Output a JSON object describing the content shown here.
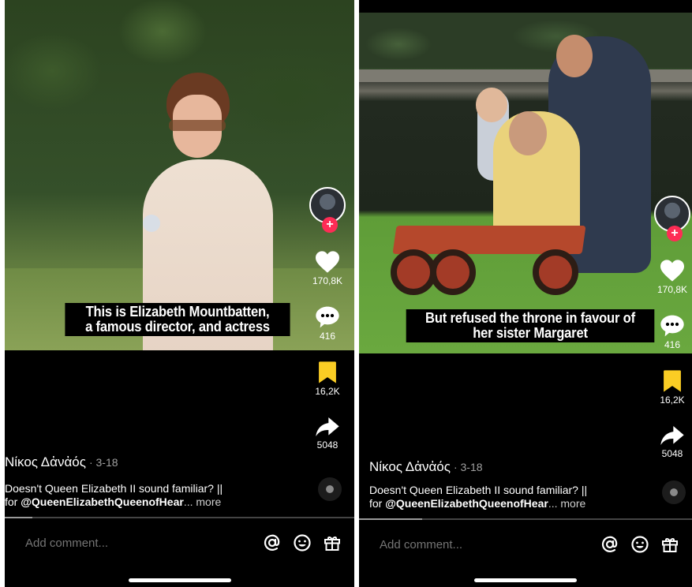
{
  "screens": [
    {
      "caption_line1": "This is Elizabeth Mountbatten,",
      "caption_line2": "a famous director, and actress",
      "likes": "170,8K",
      "comments": "416",
      "saves": "16,2K",
      "shares": "5048",
      "author": "Νίκος Δἀνἀός",
      "date": "· 3-18",
      "desc_line1": "Doesn't Queen Elizabeth II sound familiar? ||",
      "desc_prefix": "for ",
      "mention": "@QueenElizabethQueenofHear",
      "more": "... more",
      "progress": 0.08,
      "comment_placeholder": "Add comment...",
      "follow_label": "+"
    },
    {
      "caption_line1": "But refused the throne in favour of",
      "caption_line2": "her sister Margaret",
      "likes": "170,8K",
      "comments": "416",
      "saves": "16,2K",
      "shares": "5048",
      "author": "Νίκος Δἀνἀός",
      "date": "· 3-18",
      "desc_line1": "Doesn't Queen Elizabeth II sound familiar? ||",
      "desc_prefix": "for ",
      "mention": "@QueenElizabethQueenofHear",
      "more": "... more",
      "progress": 0.19,
      "comment_placeholder": "Add comment...",
      "follow_label": "+"
    }
  ],
  "colors": {
    "background": "#000000",
    "follow_badge": "#fe2c55",
    "bookmark_active": "#facd24",
    "text_primary": "#ffffff",
    "text_secondary": "#a0a0a0"
  },
  "icons": [
    "heart-icon",
    "comment-icon",
    "bookmark-icon",
    "share-icon",
    "at-mention-icon",
    "emoji-icon",
    "gift-icon"
  ]
}
